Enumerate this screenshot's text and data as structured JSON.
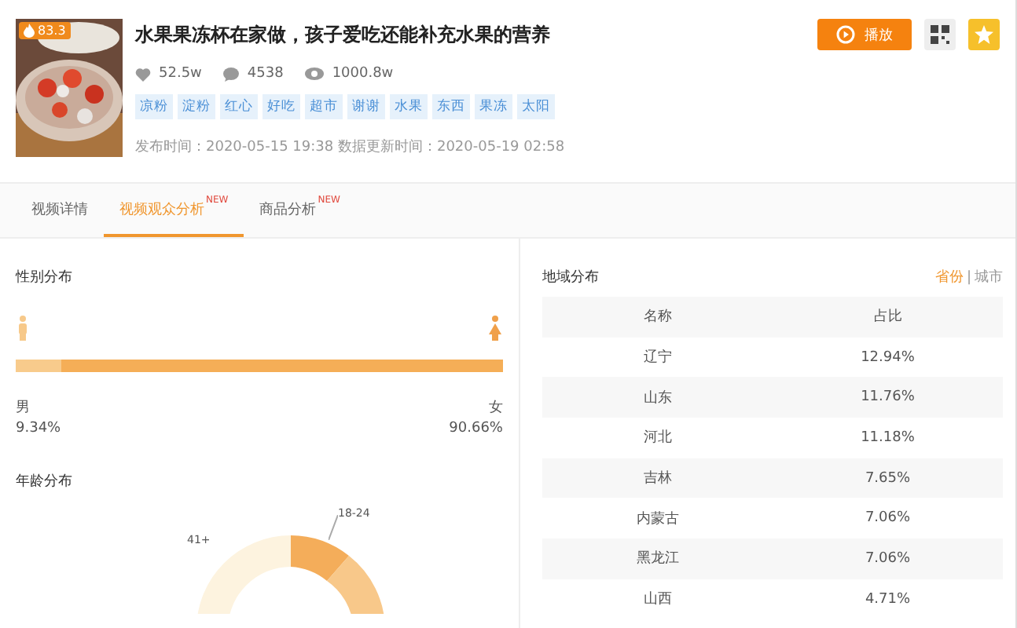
{
  "video": {
    "heat": "83.3",
    "title": "水果果冻杯在家做，孩子爱吃还能补充水果的营养",
    "likes": "52.5w",
    "comments": "4538",
    "views": "1000.8w",
    "tags": [
      "凉粉",
      "淀粉",
      "红心",
      "好吃",
      "超市",
      "谢谢",
      "水果",
      "东西",
      "果冻",
      "太阳"
    ],
    "dates": "发布时间：2020-05-15 19:38 数据更新时间：2020-05-19 02:58"
  },
  "actions": {
    "play": "播放"
  },
  "tabs": [
    {
      "label": "视频详情",
      "selected": false
    },
    {
      "label": "视频观众分析",
      "selected": true,
      "badge": "NEW"
    },
    {
      "label": "商品分析",
      "selected": false,
      "badge": "NEW"
    }
  ],
  "gender": {
    "title": "性别分布",
    "male_label": "男",
    "male_value": "9.34%",
    "level": 0.0934,
    "female_label": "女",
    "female_value": "90.66%"
  },
  "age": {
    "title": "年龄分布",
    "labels": [
      "18-24",
      "41+"
    ]
  },
  "region": {
    "title": "地域分布",
    "toggles": [
      {
        "label": "省份",
        "selected": true
      },
      {
        "label": "城市",
        "selected": false
      }
    ],
    "separator": "|",
    "columns": [
      "名称",
      "占比"
    ],
    "rows": [
      [
        "辽宁",
        "12.94%"
      ],
      [
        "山东",
        "11.76%"
      ],
      [
        "河北",
        "11.18%"
      ],
      [
        "吉林",
        "7.65%"
      ],
      [
        "内蒙古",
        "7.06%"
      ],
      [
        "黑龙江",
        "7.06%"
      ],
      [
        "山西",
        "4.71%"
      ]
    ]
  }
}
